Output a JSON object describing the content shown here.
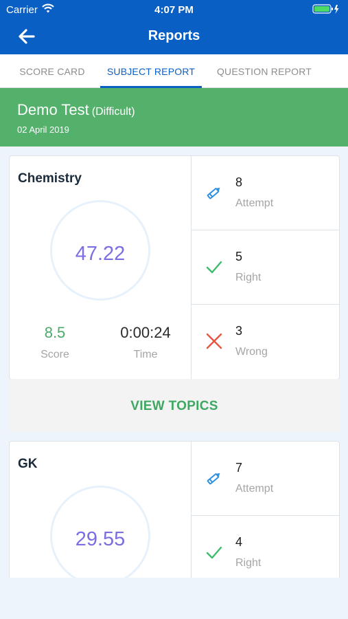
{
  "status_bar": {
    "carrier": "Carrier",
    "time": "4:07 PM"
  },
  "header": {
    "title": "Reports"
  },
  "tabs": [
    {
      "label": "SCORE CARD"
    },
    {
      "label": "SUBJECT REPORT"
    },
    {
      "label": "QUESTION REPORT"
    }
  ],
  "active_tab": "SUBJECT REPORT",
  "test": {
    "name": "Demo Test",
    "difficulty": "(Difficult)",
    "date": "02 April 2019"
  },
  "subjects": [
    {
      "name": "Chemistry",
      "percentage": "47.22",
      "score_value": "8.5",
      "score_label": "Score",
      "time_value": "0:00:24",
      "time_label": "Time",
      "attempt_count": "8",
      "attempt_label": "Attempt",
      "right_count": "5",
      "right_label": "Right",
      "wrong_count": "3",
      "wrong_label": "Wrong",
      "view_topics": "VIEW TOPICS"
    },
    {
      "name": "GK",
      "percentage": "29.55",
      "attempt_count": "7",
      "attempt_label": "Attempt",
      "right_count": "4",
      "right_label": "Right"
    }
  ],
  "colors": {
    "header_blue": "#0a5fc4",
    "banner_green": "#53b16c",
    "percentage_purple": "#7a6ee0",
    "score_green": "#4aaa68",
    "attempt_blue": "#2f8fe0",
    "right_green": "#3dbb6d",
    "wrong_red": "#e8533f"
  },
  "icons": [
    "wifi-icon",
    "battery-icon",
    "back-arrow-icon",
    "pencil-icon",
    "checkmark-icon",
    "cross-icon"
  ]
}
